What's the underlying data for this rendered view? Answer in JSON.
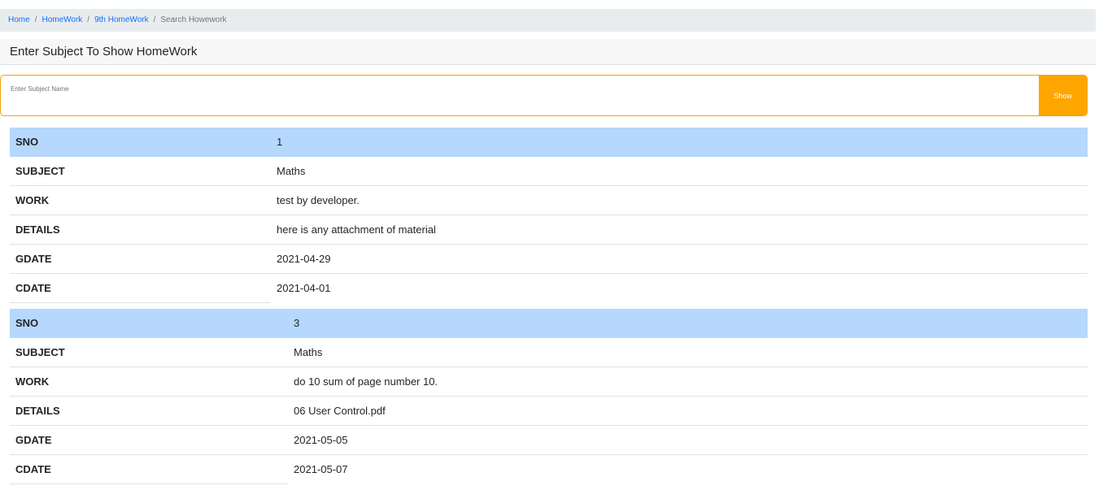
{
  "breadcrumb": {
    "items": [
      "Home",
      "HomeWork",
      "9th HomeWork"
    ],
    "active": "Search Howework"
  },
  "header": {
    "title": "Enter Subject To Show HomeWork"
  },
  "search": {
    "label": "Enter Subject Name",
    "value": "",
    "button_label": "Show"
  },
  "colors": {
    "row_highlight": "#b6d8fc",
    "accent": "#ffa500",
    "link": "#0d6efd"
  },
  "records": [
    {
      "rows": [
        {
          "key": "SNO",
          "value": "1"
        },
        {
          "key": "SUBJECT",
          "value": "Maths"
        },
        {
          "key": "WORK",
          "value": "test by developer."
        },
        {
          "key": "DETAILS",
          "value": "here is any attachment of material"
        },
        {
          "key": "GDATE",
          "value": "2021-04-29"
        },
        {
          "key": "CDATE",
          "value": "2021-04-01"
        }
      ]
    },
    {
      "rows": [
        {
          "key": "SNO",
          "value": "3"
        },
        {
          "key": "SUBJECT",
          "value": "Maths"
        },
        {
          "key": "WORK",
          "value": "do 10 sum of page number 10."
        },
        {
          "key": "DETAILS",
          "value": "06 User Control.pdf"
        },
        {
          "key": "GDATE",
          "value": "2021-05-05"
        },
        {
          "key": "CDATE",
          "value": "2021-05-07"
        }
      ]
    }
  ]
}
